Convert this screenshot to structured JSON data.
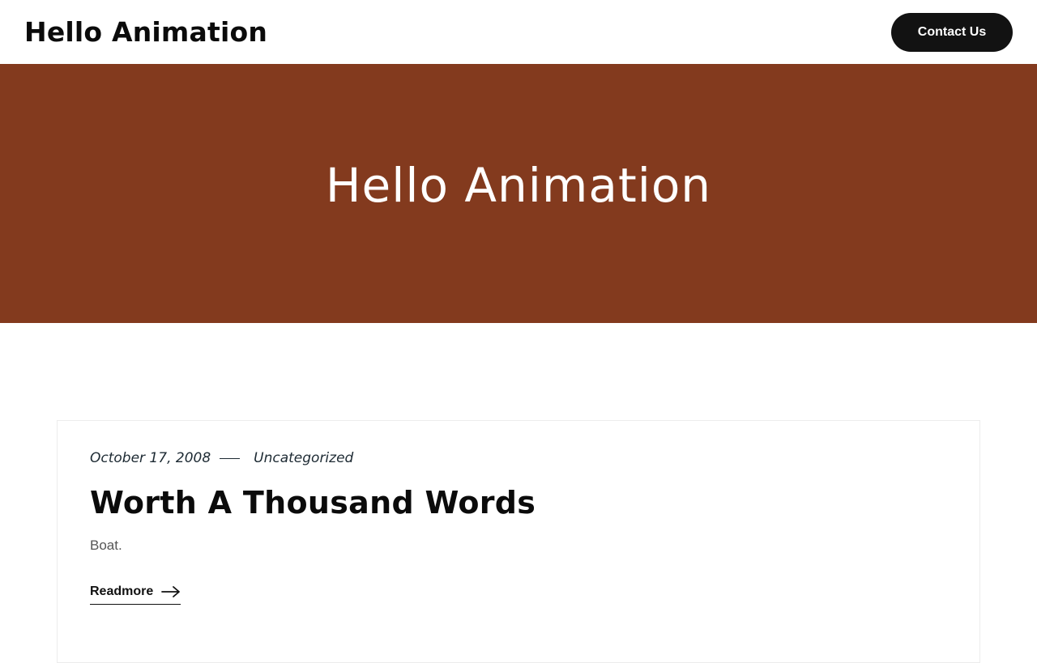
{
  "header": {
    "site_title": "Hello Animation",
    "contact_label": "Contact Us"
  },
  "hero": {
    "title": "Hello Animation",
    "background_color": "#833a1e"
  },
  "post": {
    "date": "October 17, 2008",
    "category": "Uncategorized",
    "title": "Worth A Thousand Words",
    "excerpt": "Boat.",
    "readmore_label": "Readmore",
    "readmore_icon": "arrow-right-icon"
  }
}
